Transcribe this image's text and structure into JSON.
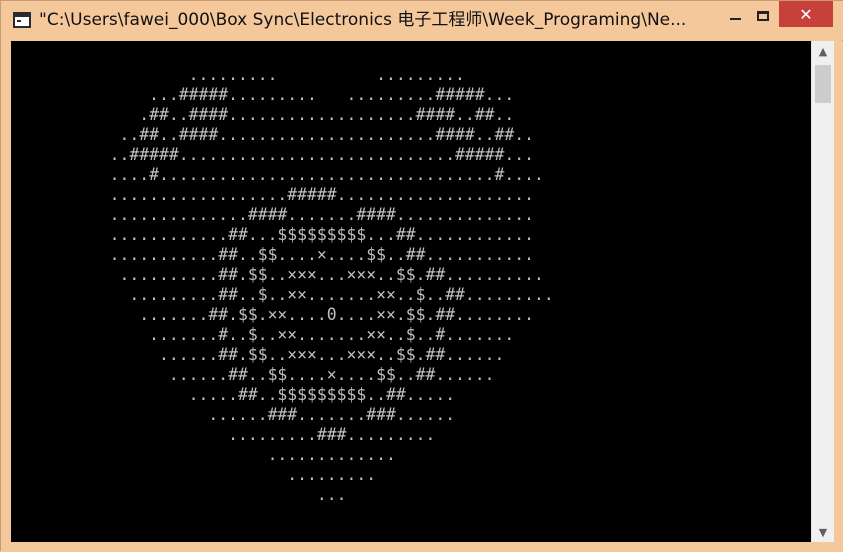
{
  "window": {
    "title": "\"C:\\Users\\fawei_000\\Box Sync\\Electronics 电子工程师\\Week_Programing\\Ne...",
    "close_glyph": "✕"
  },
  "scrollbar": {
    "up_glyph": "▲",
    "down_glyph": "▼"
  },
  "console": {
    "lines": [
      "                  .........          .........",
      "              ...#####.........   .........#####...",
      "             .##..####...................####..##..",
      "           ..##..####......................####..##..",
      "          ..#####............................#####...",
      "          ....#..................................#....",
      "          ..................#####....................",
      "          ..............####.......####..............",
      "          ............##...$$$$$$$$$...##............",
      "          ...........##..$$....×....$$..##...........",
      "           ..........##.$$..×××...×××..$$.##..........",
      "            .........##..$..××.......××..$..##.........",
      "             .......##.$$.××....0....××.$$.##........",
      "              .......#..$..××.......××..$..#.......",
      "               ......##.$$..×××...×××..$$.##......",
      "                ......##..$$....×....$$..##......",
      "                  .....##..$$$$$$$$$..##.....",
      "                    ......###.......###......",
      "                      .........###.........",
      "                          .............",
      "                            .........",
      "                               ..."
    ]
  }
}
